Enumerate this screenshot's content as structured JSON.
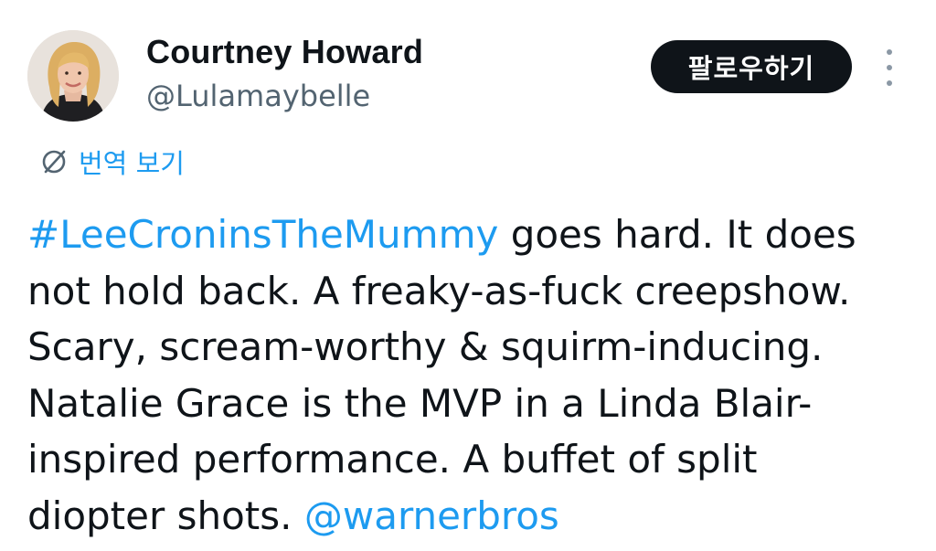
{
  "author": {
    "display_name": "Courtney Howard",
    "handle": "@Lulamaybelle"
  },
  "actions": {
    "follow_label": "팔로우하기",
    "more_icon": "more-vertical-icon"
  },
  "translate": {
    "label": "번역 보기",
    "icon": "globe-translate-icon"
  },
  "tweet": {
    "hashtag": "#LeeCroninsTheMummy",
    "line1_rest": " goes hard. It does",
    "line2": "not hold back. A freaky-as-fuck creepshow.",
    "line3": "Scary, scream-worthy & squirm-inducing.",
    "line4": "Natalie Grace is the MVP in a Linda Blair-",
    "line5": "inspired performance. A buffet of split",
    "line6_text": "diopter shots. ",
    "mention": "@warnerbros"
  },
  "colors": {
    "link": "#1d9bf0",
    "text": "#0f1419",
    "secondary": "#536471",
    "button_bg": "#0f1419"
  }
}
